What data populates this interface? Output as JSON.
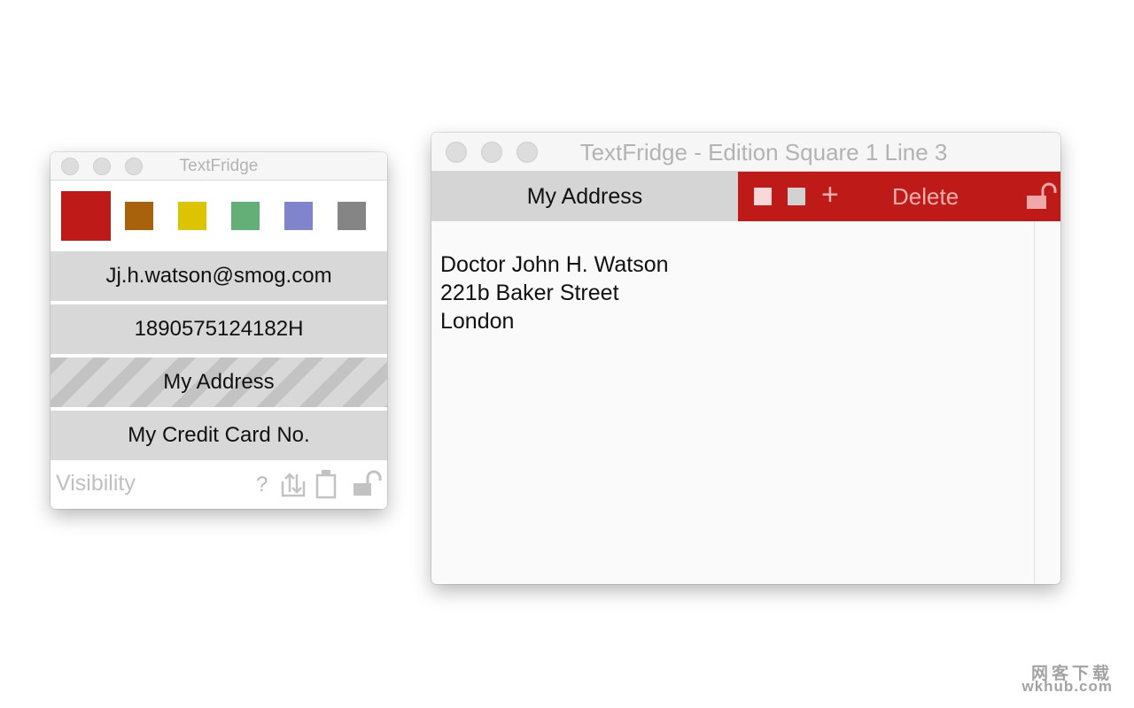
{
  "small_window": {
    "title": "TextFridge",
    "colors": [
      "#be1a18",
      "#a8620c",
      "#dcc400",
      "#64ae78",
      "#7f84cc",
      "#858585"
    ],
    "items": [
      {
        "label": "Jj.h.watson@smog.com",
        "hidden": false
      },
      {
        "label": "1890575124182H",
        "hidden": false
      },
      {
        "label": "My Address",
        "hidden": true
      },
      {
        "label": "My Credit Card No.",
        "hidden": false
      }
    ],
    "footer": {
      "visibility_label": "Visibility",
      "help_label": "?",
      "icons": [
        "import-export-icon",
        "clipboard-icon",
        "unlock-icon"
      ]
    }
  },
  "big_window": {
    "title": "TextFridge - Edition Square 1 Line 3",
    "tab_label": "My Address",
    "toolbar": {
      "plus_label": "+",
      "delete_label": "Delete",
      "icons": [
        "square-white-icon",
        "square-gray-icon",
        "unlock-icon"
      ]
    },
    "content_text": "Doctor John H. Watson\n221b Baker Street\nLondon"
  },
  "watermark": {
    "line1": "网客下载",
    "line2": "wkhub.com"
  }
}
